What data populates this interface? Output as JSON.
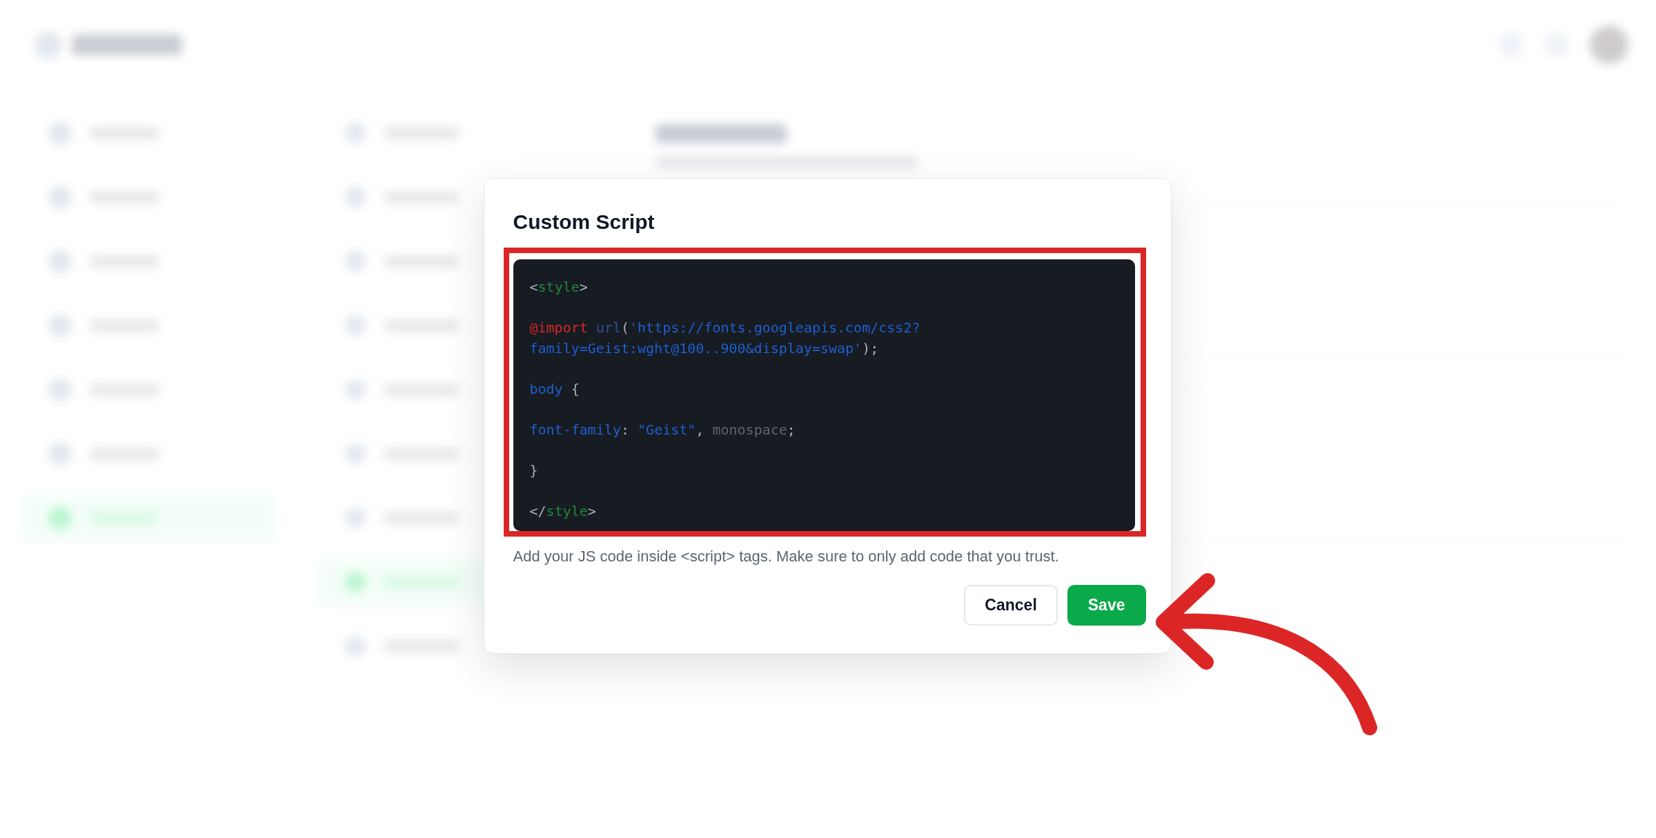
{
  "dialog": {
    "title": "Custom Script",
    "code_lines": [
      [
        {
          "tokens": [
            {
              "text": "<",
              "kind": "punct"
            },
            {
              "text": "style",
              "kind": "tag"
            },
            {
              "text": ">",
              "kind": "punct"
            }
          ]
        }
      ],
      [
        {
          "tokens": [
            {
              "text": "@import",
              "kind": "at"
            },
            {
              "text": " url",
              "kind": "fn"
            },
            {
              "text": "(",
              "kind": "punct"
            },
            {
              "text": "'https://fonts.googleapis.com/css2?",
              "kind": "string"
            }
          ]
        },
        {
          "tokens": [
            {
              "text": "family=Geist:wght@100..900&display=swap'",
              "kind": "string"
            },
            {
              "text": ");",
              "kind": "punct"
            }
          ]
        }
      ],
      [
        {
          "tokens": [
            {
              "text": "body",
              "kind": "string"
            },
            {
              "text": " {",
              "kind": "punct"
            }
          ]
        }
      ],
      [
        {
          "tokens": [
            {
              "text": "font-family",
              "kind": "string"
            },
            {
              "text": ": ",
              "kind": "punct"
            },
            {
              "text": "\"Geist\"",
              "kind": "string"
            },
            {
              "text": ", ",
              "kind": "punct"
            },
            {
              "text": "monospace",
              "kind": "muted"
            },
            {
              "text": ";",
              "kind": "punct"
            }
          ]
        }
      ],
      [
        {
          "tokens": [
            {
              "text": "}",
              "kind": "punct"
            }
          ]
        }
      ],
      [
        {
          "tokens": [
            {
              "text": "</",
              "kind": "punct"
            },
            {
              "text": "style",
              "kind": "tag"
            },
            {
              "text": ">",
              "kind": "punct"
            }
          ]
        }
      ]
    ],
    "highlighted": true,
    "help": "Add your JS code inside <script> tags. Make sure to only add code that you trust.",
    "buttons": [
      {
        "label": "Cancel",
        "kind": "secondary"
      },
      {
        "label": "Save",
        "kind": "primary"
      }
    ]
  }
}
